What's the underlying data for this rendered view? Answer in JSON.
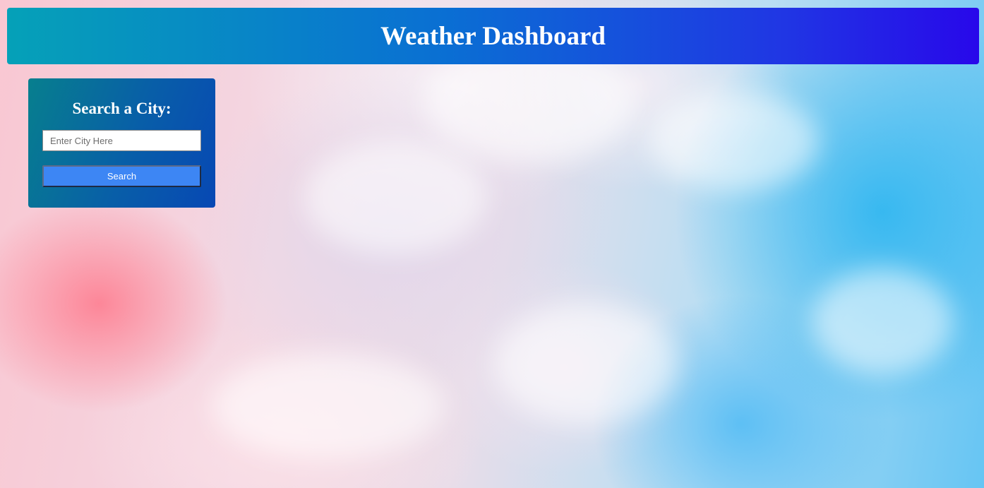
{
  "header": {
    "title": "Weather Dashboard"
  },
  "search": {
    "heading": "Search a City:",
    "input_value": "",
    "input_placeholder": "Enter City Here",
    "button_label": "Search"
  },
  "colors": {
    "header_gradient_start": "#05a1b8",
    "header_gradient_end": "#2808ea",
    "panel_gradient_start": "#077f8e",
    "panel_gradient_end": "#0748b4",
    "button": "#3d86f4",
    "text": "#ffffff"
  }
}
